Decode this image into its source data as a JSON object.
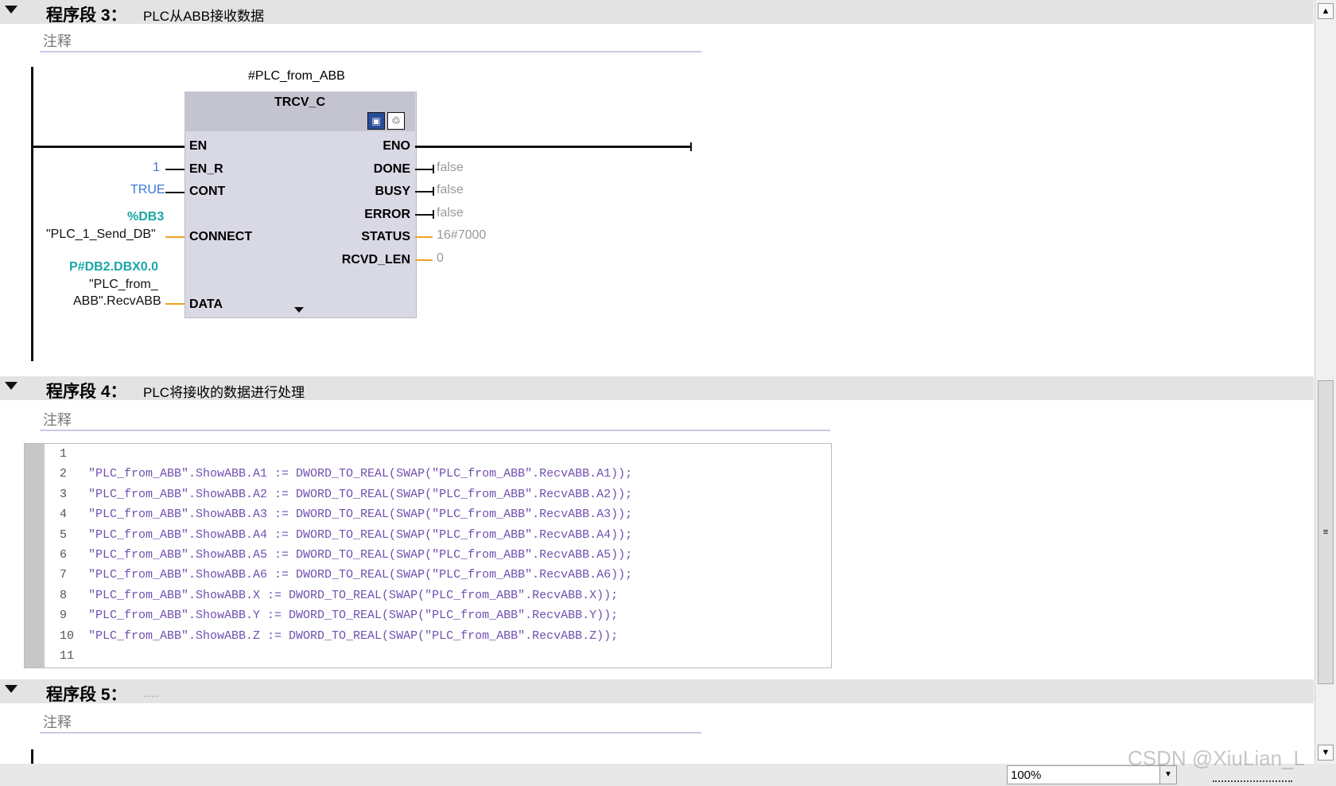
{
  "segments": [
    {
      "label": "程序段 3：",
      "title": "PLC从ABB接收数据",
      "comment": "注释"
    },
    {
      "label": "程序段 4：",
      "title": "PLC将接收的数据进行处理",
      "comment": "注释"
    },
    {
      "label": "程序段 5：",
      "title": "......",
      "comment": "注释"
    }
  ],
  "fb": {
    "instance": "#PLC_from_ABB",
    "name": "TRCV_C",
    "inputs": {
      "en": "EN",
      "en_r": "EN_R",
      "cont": "CONT",
      "connect": "CONNECT",
      "data": "DATA"
    },
    "outputs": {
      "eno": "ENO",
      "done": "DONE",
      "busy": "BUSY",
      "error": "ERROR",
      "status": "STATUS",
      "rcvd_len": "RCVD_LEN"
    },
    "input_values": {
      "en_r": "1",
      "cont": "TRUE",
      "connect_addr": "%DB3",
      "connect_tag": "\"PLC_1_Send_DB\"",
      "data_addr": "P#DB2.DBX0.0",
      "data_tag_1": "\"PLC_from_",
      "data_tag_2": "ABB\".RecvABB"
    },
    "output_values": {
      "done": "false",
      "busy": "false",
      "error": "false",
      "status": "16#7000",
      "rcvd_len": "0"
    }
  },
  "code_lines": [
    {
      "n": "1",
      "text": ""
    },
    {
      "n": "2",
      "text": "\"PLC_from_ABB\".ShowABB.A1 := DWORD_TO_REAL(SWAP(\"PLC_from_ABB\".RecvABB.A1));"
    },
    {
      "n": "3",
      "text": "\"PLC_from_ABB\".ShowABB.A2 := DWORD_TO_REAL(SWAP(\"PLC_from_ABB\".RecvABB.A2));"
    },
    {
      "n": "4",
      "text": "\"PLC_from_ABB\".ShowABB.A3 := DWORD_TO_REAL(SWAP(\"PLC_from_ABB\".RecvABB.A3));"
    },
    {
      "n": "5",
      "text": "\"PLC_from_ABB\".ShowABB.A4 := DWORD_TO_REAL(SWAP(\"PLC_from_ABB\".RecvABB.A4));"
    },
    {
      "n": "6",
      "text": "\"PLC_from_ABB\".ShowABB.A5 := DWORD_TO_REAL(SWAP(\"PLC_from_ABB\".RecvABB.A5));"
    },
    {
      "n": "7",
      "text": "\"PLC_from_ABB\".ShowABB.A6 := DWORD_TO_REAL(SWAP(\"PLC_from_ABB\".RecvABB.A6));"
    },
    {
      "n": "8",
      "text": "\"PLC_from_ABB\".ShowABB.X := DWORD_TO_REAL(SWAP(\"PLC_from_ABB\".RecvABB.X));"
    },
    {
      "n": "9",
      "text": "\"PLC_from_ABB\".ShowABB.Y := DWORD_TO_REAL(SWAP(\"PLC_from_ABB\".RecvABB.Y));"
    },
    {
      "n": "10",
      "text": "\"PLC_from_ABB\".ShowABB.Z := DWORD_TO_REAL(SWAP(\"PLC_from_ABB\".RecvABB.Z));"
    },
    {
      "n": "11",
      "text": ""
    }
  ],
  "status": {
    "zoom": "100%",
    "watermark": "CSDN @XiuLian_L"
  },
  "colors": {
    "string": "#7050b0",
    "fn_blue": "#3c78d8",
    "teal": "#1aa6a6",
    "wire_orange": "#f0a020",
    "header_bg": "#e3e3e3"
  },
  "icons": [
    "collapse-triangle-icon",
    "fb-block-icon",
    "fb-watch-icon",
    "scroll-up-icon",
    "scroll-down-icon",
    "dropdown-arrow-icon"
  ]
}
